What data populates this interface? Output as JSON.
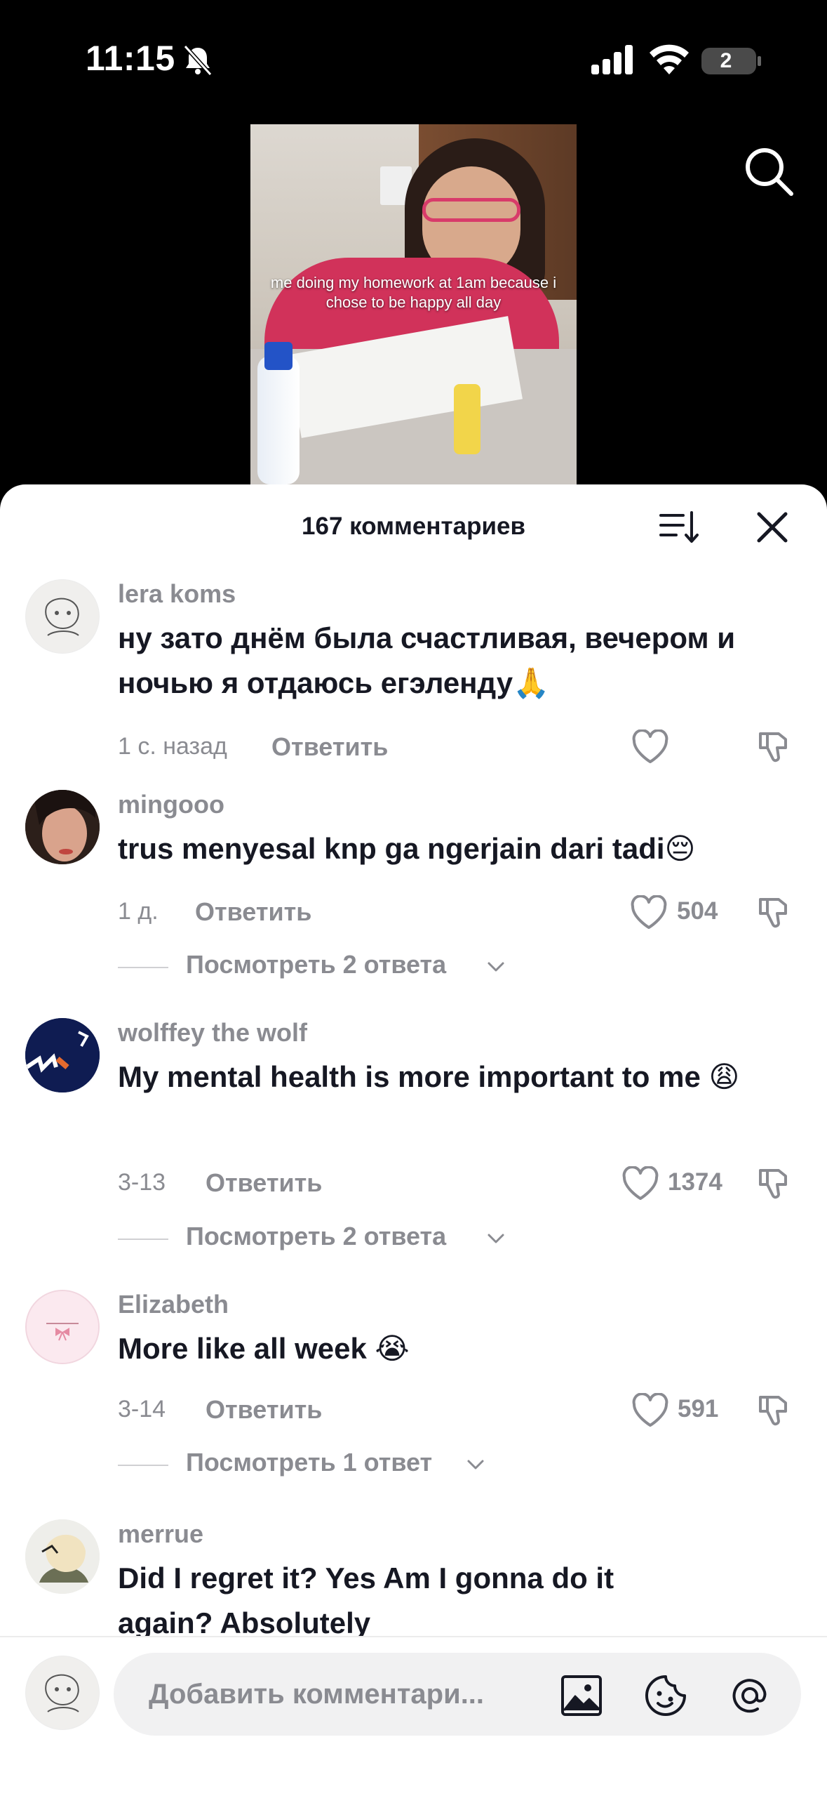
{
  "status": {
    "time": "11:15",
    "battery": "2"
  },
  "video": {
    "caption": "me doing my homework at 1am because i chose to be happy all day"
  },
  "sheet": {
    "title": "167 комментариев"
  },
  "comments": [
    {
      "user": "lera koms",
      "text": "ну зато днём была счастливая, вечером и ночью я отдаюсь егэленду🙏",
      "date": "1 с. назад",
      "reply": "Ответить",
      "likes": "",
      "replies": ""
    },
    {
      "user": "mingooo",
      "text": "trus menyesal knp ga ngerjain dari tadi😔",
      "date": "1 д.",
      "reply": "Ответить",
      "likes": "504",
      "replies": "Посмотреть 2 ответа"
    },
    {
      "user": "wolffey the wolf",
      "text": "My mental health is more important to me 😩",
      "date": "3-13",
      "reply": "Ответить",
      "likes": "1374",
      "replies": "Посмотреть 2 ответа"
    },
    {
      "user": "Elizabeth",
      "text": "More like all week 😭",
      "date": "3-14",
      "reply": "Ответить",
      "likes": "591",
      "replies": "Посмотреть 1 ответ"
    },
    {
      "user": "merrue",
      "text": "Did I regret it? Yes Am I gonna do it again? Absolutely",
      "date": "",
      "reply": "",
      "likes": "",
      "replies": ""
    }
  ],
  "composer": {
    "placeholder": "Добавить комментари..."
  },
  "icons": [
    "bell-slash-icon",
    "signal-icon",
    "wifi-icon",
    "battery-icon",
    "search-icon",
    "sort-icon",
    "close-icon",
    "heart-icon",
    "dislike-icon",
    "chevron-down-icon",
    "image-icon",
    "emoji-icon",
    "mention-icon"
  ]
}
